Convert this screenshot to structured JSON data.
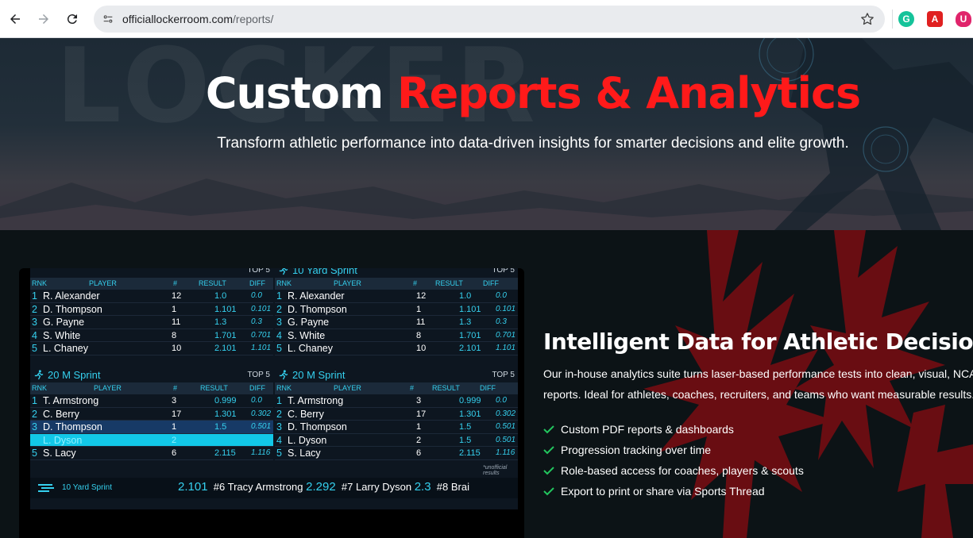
{
  "browser": {
    "url_domain": "officiallockerroom.com",
    "url_path": "/reports/",
    "icons": [
      "back-arrow-icon",
      "forward-arrow-icon",
      "reload-icon",
      "site-info-icon",
      "bookmark-star-icon"
    ],
    "extensions": [
      {
        "name": "grammarly-extension-icon",
        "glyph": "G",
        "color": "#15c39a"
      },
      {
        "name": "pdf-extension-icon",
        "glyph": "A",
        "color": "#e02020"
      },
      {
        "name": "ublock-extension-icon",
        "glyph": "U",
        "color": "#e0246b"
      }
    ]
  },
  "hero": {
    "title_white": "Custom",
    "title_red": "Reports & Analytics",
    "subtitle": "Transform athletic performance into data-driven insights for smarter decisions and elite growth.",
    "accent_color": "#ff1a1a"
  },
  "scoreboard": {
    "panels": [
      {
        "title": "",
        "top5": "TOP 5",
        "head": {
          "rnk": "RNK",
          "player": "PLAYER",
          "no": "#",
          "result": "RESULT",
          "diff": "DIFF"
        },
        "rows": [
          {
            "rank": "1",
            "name": "R. Alexander",
            "no": "12",
            "result": "1.0",
            "diff": "0.0"
          },
          {
            "rank": "2",
            "name": "D. Thompson",
            "no": "1",
            "result": "1.101",
            "diff": "0.101"
          },
          {
            "rank": "3",
            "name": "G. Payne",
            "no": "11",
            "result": "1.3",
            "diff": "0.3"
          },
          {
            "rank": "4",
            "name": "S. White",
            "no": "8",
            "result": "1.701",
            "diff": "0.701"
          },
          {
            "rank": "5",
            "name": "L. Chaney",
            "no": "10",
            "result": "2.101",
            "diff": "1.101"
          }
        ]
      },
      {
        "title": "10 Yard Sprint",
        "top5": "TOP 5",
        "head": {
          "rnk": "RNK",
          "player": "PLAYER",
          "no": "#",
          "result": "RESULT",
          "diff": "DIFF"
        },
        "rows": [
          {
            "rank": "1",
            "name": "R. Alexander",
            "no": "12",
            "result": "1.0",
            "diff": "0.0"
          },
          {
            "rank": "2",
            "name": "D. Thompson",
            "no": "1",
            "result": "1.101",
            "diff": "0.101"
          },
          {
            "rank": "3",
            "name": "G. Payne",
            "no": "11",
            "result": "1.3",
            "diff": "0.3"
          },
          {
            "rank": "4",
            "name": "S. White",
            "no": "8",
            "result": "1.701",
            "diff": "0.701"
          },
          {
            "rank": "5",
            "name": "L. Chaney",
            "no": "10",
            "result": "2.101",
            "diff": "1.101"
          }
        ]
      },
      {
        "title": "20 M Sprint",
        "top5": "TOP 5",
        "head": {
          "rnk": "RNK",
          "player": "PLAYER",
          "no": "#",
          "result": "RESULT",
          "diff": "DIFF"
        },
        "rows": [
          {
            "rank": "1",
            "name": "T. Armstrong",
            "no": "3",
            "result": "0.999",
            "diff": "0.0"
          },
          {
            "rank": "2",
            "name": "C. Berry",
            "no": "17",
            "result": "1.301",
            "diff": "0.302"
          },
          {
            "rank": "3",
            "name": "D. Thompson",
            "no": "1",
            "result": "1.5",
            "diff": "0.501"
          },
          {
            "rank": "",
            "name": "L. Dyson",
            "no": "2",
            "result": "",
            "diff": "",
            "highlight": true
          },
          {
            "rank": "5",
            "name": "S. Lacy",
            "no": "6",
            "result": "2.115",
            "diff": "1.116"
          }
        ]
      },
      {
        "title": "20 M Sprint",
        "top5": "TOP 5",
        "head": {
          "rnk": "RNK",
          "player": "PLAYER",
          "no": "#",
          "result": "RESULT",
          "diff": "DIFF"
        },
        "rows": [
          {
            "rank": "1",
            "name": "T. Armstrong",
            "no": "3",
            "result": "0.999",
            "diff": "0.0"
          },
          {
            "rank": "2",
            "name": "C. Berry",
            "no": "17",
            "result": "1.301",
            "diff": "0.302"
          },
          {
            "rank": "3",
            "name": "D. Thompson",
            "no": "1",
            "result": "1.5",
            "diff": "0.501"
          },
          {
            "rank": "4",
            "name": "L. Dyson",
            "no": "2",
            "result": "1.5",
            "diff": "0.501"
          },
          {
            "rank": "5",
            "name": "S. Lacy",
            "no": "6",
            "result": "2.115",
            "diff": "1.116"
          }
        ]
      }
    ],
    "unofficial_note": "*unofficial results",
    "ticker_label": "10 Yard Sprint",
    "ticker": {
      "t1": "2.101",
      "t2": "#6 Tracy Armstrong",
      "t3": "2.292",
      "t4": "#7 Larry Dyson",
      "t5": "2.3",
      "t6": "#8 Brai"
    }
  },
  "feature": {
    "title": "Intelligent Data for Athletic Decisions",
    "desc_line1": "Our in-house analytics suite turns laser-based performance tests into clean, visual, NCA",
    "desc_line2": "reports. Ideal for athletes, coaches, recruiters, and teams who want measurable results.",
    "check_color": "#22c55e",
    "items": [
      "Custom PDF reports & dashboards",
      "Progression tracking over time",
      "Role-based access for coaches, players & scouts",
      "Export to print or share via Sports Thread"
    ]
  }
}
